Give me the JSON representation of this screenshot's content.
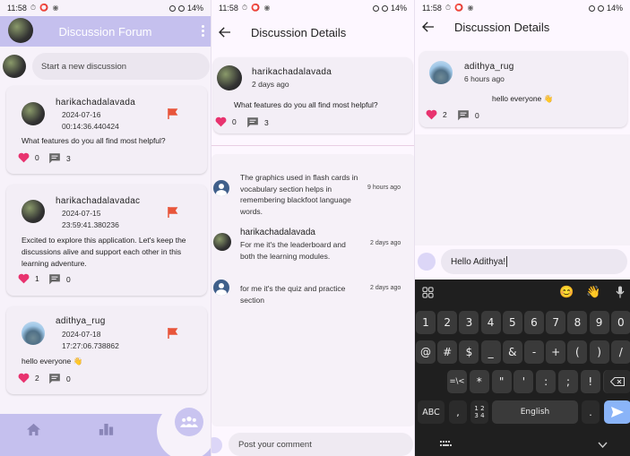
{
  "status": {
    "time": "11:58",
    "battery": "14%",
    "indicators": "⏱ ⭕ ◉"
  },
  "forum": {
    "title": "Discussion Forum",
    "new_discussion_placeholder": "Start a new discussion",
    "posts": [
      {
        "author": "harikachadalavada",
        "date": "2024-07-16",
        "time": "00:14:36.440424",
        "body": "What features do you all find most helpful?",
        "likes": "0",
        "comments": "3"
      },
      {
        "author": "harikachadalavadac",
        "date": "2024-07-15",
        "time": "23:59:41.380236",
        "body": "Excited to explore this application. Let's keep the discussions alive and support each other in this learning adventure.",
        "likes": "1",
        "comments": "0"
      },
      {
        "author": "adithya_rug",
        "date": "2024-07-18",
        "time": "17:27:06.738862",
        "body": "hello everyone 👋",
        "likes": "2",
        "comments": "0"
      }
    ]
  },
  "details1": {
    "title": "Discussion Details",
    "author": "harikachadalavada",
    "ago": "2 days ago",
    "body": "What features do you all find most helpful?",
    "likes": "0",
    "comments": "3",
    "replies": [
      {
        "text": "The graphics used in flash cards in vocabulary section helps in remembering blackfoot language words.",
        "ago": "9 hours ago",
        "name": ""
      },
      {
        "name": "harikachadalavada",
        "text": "For me it's the leaderboard and both the learning modules.",
        "ago": "2 days ago"
      },
      {
        "text": "for me it's the quiz and practice section",
        "ago": "2 days ago",
        "name": ""
      }
    ],
    "comment_placeholder": "Post your comment"
  },
  "details2": {
    "title": "Discussion Details",
    "author": "adithya_rug",
    "ago": "6 hours ago",
    "body": "hello everyone 👋",
    "likes": "2",
    "comments": "0",
    "input_value": "Hello Adithya!"
  },
  "keyboard": {
    "row1": [
      "1",
      "2",
      "3",
      "4",
      "5",
      "6",
      "7",
      "8",
      "9",
      "0"
    ],
    "row2": [
      "@",
      "#",
      "$",
      "_",
      "&",
      "-",
      "+",
      "(",
      ")",
      "/"
    ],
    "row3": [
      "=\\<",
      "*",
      "\"",
      "'",
      ":",
      ";",
      "!",
      "?"
    ],
    "abc": "ABC",
    "comma": ",",
    "numpad": "1 2\n3 4",
    "space": "English",
    "period": ".",
    "emoji_top": [
      "😊",
      "👋"
    ]
  },
  "colors": {
    "accent": "#c5c0ee",
    "flag": "#e8553a",
    "heart": "#e8336f",
    "keyboard_bg": "#1f1f1f",
    "send": "#8ab4f8"
  }
}
